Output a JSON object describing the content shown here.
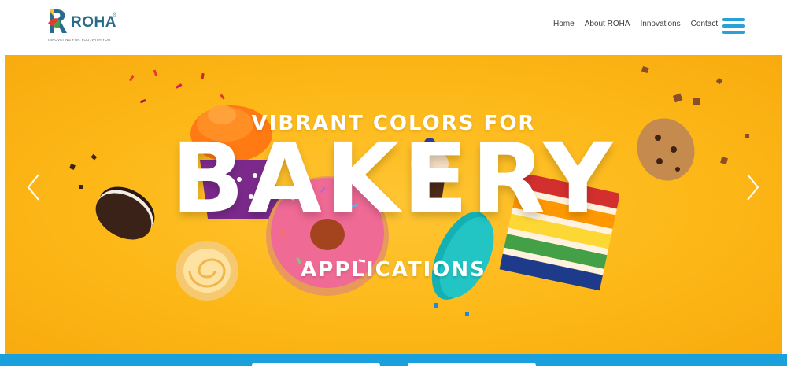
{
  "brand": {
    "name": "ROHA",
    "reg": "®",
    "tagline": "INNOVATING FOR YOU, WITH YOU"
  },
  "nav": {
    "items": [
      {
        "label": "Home"
      },
      {
        "label": "About ROHA"
      },
      {
        "label": "Innovations"
      },
      {
        "label": "Contact"
      }
    ]
  },
  "hero": {
    "headline_top": "VIBRANT COLORS FOR",
    "headline_main": "BAKERY",
    "headline_bottom": "APPLICATIONS"
  },
  "colors": {
    "accent_blue": "#1aa0dc",
    "hero_yellow": "#fdb818",
    "logo_teal": "#2a6a8a"
  },
  "icons": {
    "menu": "hamburger-menu-icon",
    "prev": "chevron-left-icon",
    "next": "chevron-right-icon"
  }
}
